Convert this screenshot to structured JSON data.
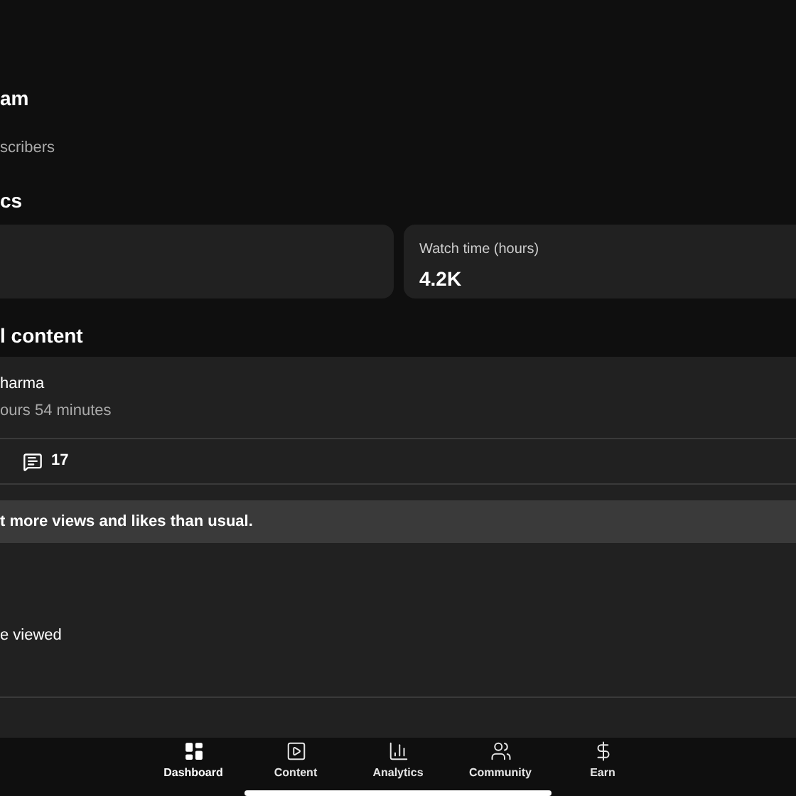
{
  "channel": {
    "name": "am",
    "subscribers": "scribers"
  },
  "analytics": {
    "title": "cs",
    "cards": [
      {
        "label": "Watch time (hours)",
        "value": "4.2K"
      }
    ]
  },
  "latest_content": {
    "title": "l content",
    "author": "harma",
    "duration": "ours 54 minutes",
    "comments": "17",
    "banner": "t more views and likes than usual.",
    "note": "e viewed"
  },
  "nav": [
    {
      "label": "Dashboard",
      "selected": true,
      "kind": "dashboard"
    },
    {
      "label": "Content",
      "selected": false,
      "kind": "content"
    },
    {
      "label": "Analytics",
      "selected": false,
      "kind": "analytics"
    },
    {
      "label": "Community",
      "selected": false,
      "kind": "community"
    },
    {
      "label": "Earn",
      "selected": false,
      "kind": "earn"
    }
  ]
}
